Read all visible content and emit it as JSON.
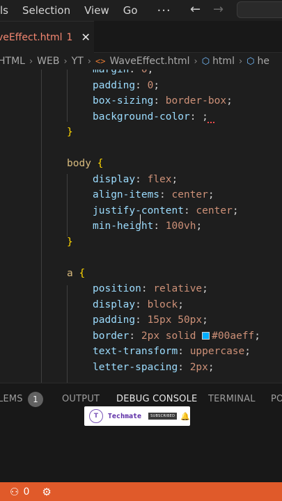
{
  "menubar": {
    "items": [
      "Selection",
      "View",
      "Go"
    ],
    "partial_first": "ls",
    "more": "···",
    "back_icon": "arrow-left-icon",
    "forward_icon": "arrow-right-icon"
  },
  "tab": {
    "name": "veEffect.html",
    "badge": "1",
    "close": "✕"
  },
  "breadcrumb": {
    "items": [
      "HTML",
      "WEB",
      "YT",
      "WaveEffect.html",
      "html",
      "he"
    ]
  },
  "editor": {
    "lines": [
      {
        "indent": 2,
        "prop": "margin",
        "val": "0",
        "partial": true
      },
      {
        "indent": 2,
        "prop": "padding",
        "val": "0"
      },
      {
        "indent": 2,
        "prop": "box-sizing",
        "val": "border-box"
      },
      {
        "indent": 2,
        "prop": "background-color",
        "val": ""
      },
      {
        "indent": 1,
        "brace": "}"
      },
      {
        "blank": true
      },
      {
        "indent": 1,
        "selector": "body",
        "brace": "{"
      },
      {
        "indent": 2,
        "prop": "display",
        "val": "flex"
      },
      {
        "indent": 2,
        "prop": "align-items",
        "val": "center"
      },
      {
        "indent": 2,
        "prop": "justify-content",
        "val": "center"
      },
      {
        "indent": 2,
        "prop": "min-height",
        "val": "100vh"
      },
      {
        "indent": 1,
        "brace": "}"
      },
      {
        "blank": true
      },
      {
        "indent": 1,
        "selector": "a",
        "brace": "{"
      },
      {
        "indent": 2,
        "prop": "position",
        "val": "relative"
      },
      {
        "indent": 2,
        "prop": "display",
        "val": "block"
      },
      {
        "indent": 2,
        "prop": "padding",
        "val": "15px 50px"
      },
      {
        "indent": 2,
        "prop": "border",
        "val": "2px solid",
        "color": "#00aeff"
      },
      {
        "indent": 2,
        "prop": "text-transform",
        "val": "uppercase"
      },
      {
        "indent": 2,
        "prop": "letter-spacing",
        "val": "2px"
      }
    ],
    "colors": {
      "swatch": "#00aeff",
      "selector": "#d7ba7d",
      "property": "#9cdcfe",
      "value": "#ce9178",
      "brace": "#ffd700"
    }
  },
  "panel": {
    "problems_partial": "LEMS",
    "problems_count": "1",
    "tabs": [
      "OUTPUT",
      "DEBUG CONSOLE",
      "TERMINAL",
      "PO"
    ],
    "active_tab": "DEBUG CONSOLE"
  },
  "watermark": {
    "name": "Techmate",
    "subscribe": "SUBSCRIBED",
    "bell_icon": "bell-icon"
  },
  "statusbar": {
    "remote_icon": "broadcast-icon",
    "count": "0",
    "debug_icon": "debug-icon",
    "color": "#e05a2a"
  }
}
